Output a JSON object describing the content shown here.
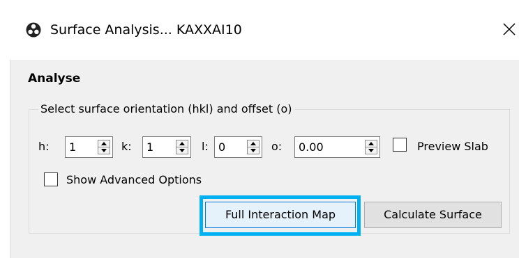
{
  "window": {
    "title": "Surface Analysis... KAXXAI10",
    "app_icon": "hazard-icon",
    "close_icon": "close-icon"
  },
  "section": {
    "title": "Analyse"
  },
  "group": {
    "legend": "Select surface orientation (hkl) and offset (o)",
    "h": {
      "label": "h:",
      "value": "1"
    },
    "k": {
      "label": "k:",
      "value": "1"
    },
    "l": {
      "label": "l:",
      "value": "0"
    },
    "o": {
      "label": "o:",
      "value": "0.00"
    },
    "preview_slab": {
      "label": "Preview Slab",
      "checked": false
    },
    "advanced": {
      "label": "Show Advanced Options",
      "checked": false
    }
  },
  "buttons": {
    "full_map": "Full Interaction Map",
    "calculate": "Calculate Surface"
  },
  "colors": {
    "highlight": "#00b0f0",
    "default_button_border": "#0078d7"
  }
}
